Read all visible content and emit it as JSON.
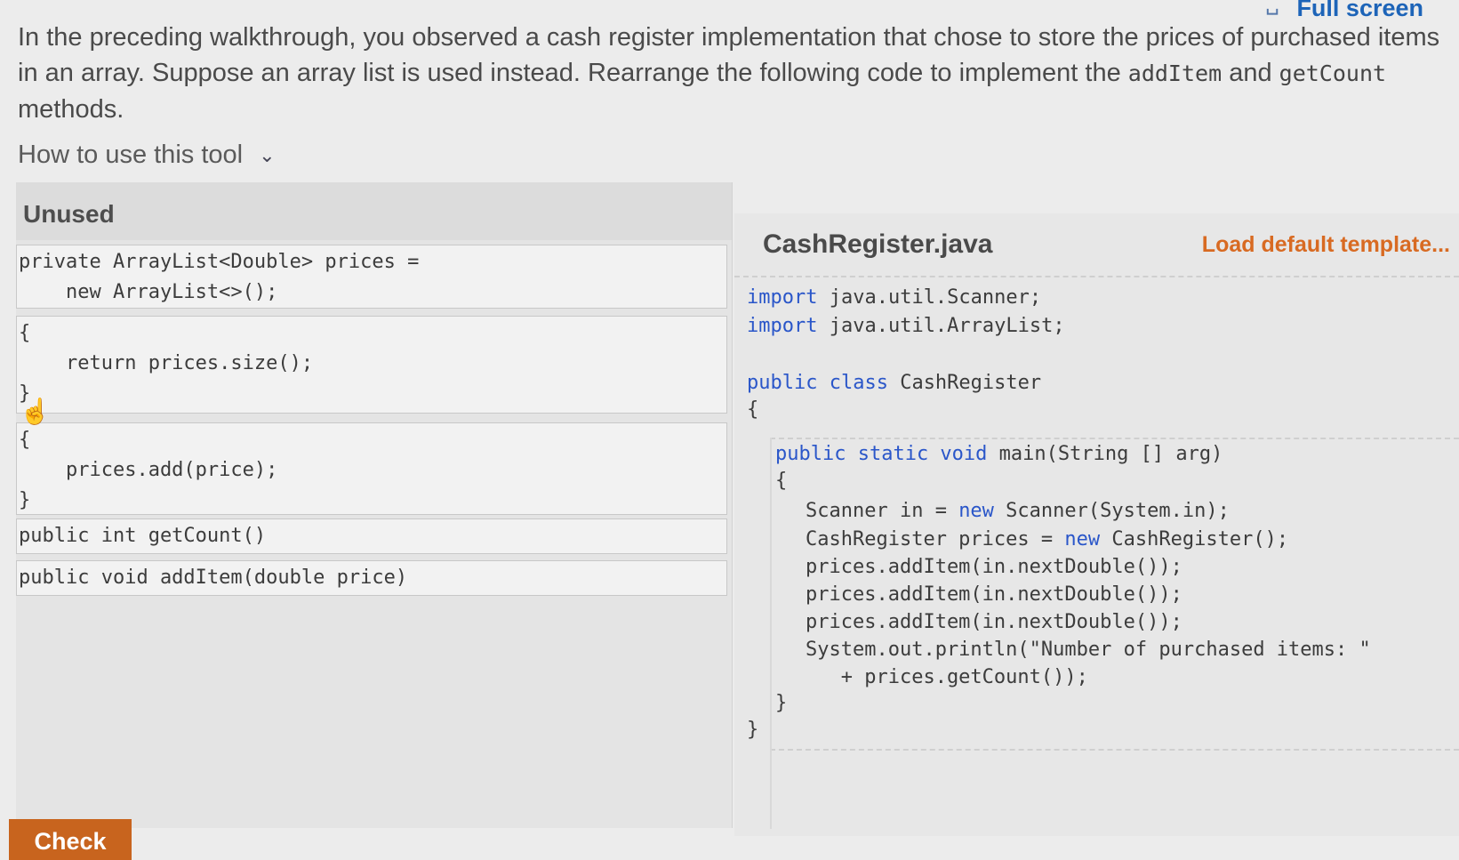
{
  "header": {
    "fullscreen_label": "Full screen",
    "fullscreen_icon": "expand-icon"
  },
  "instructions": {
    "part1": "In the preceding walkthrough, you observed a cash register implementation that chose to store the prices of purchased items in an array. Suppose an array list is used instead. Rearrange the following code to implement the ",
    "code1": "addItem",
    "part2": " and ",
    "code2": "getCount",
    "part3": " methods."
  },
  "howto": {
    "label": "How to use this tool",
    "icon": "chevron-down-icon"
  },
  "unused": {
    "title": "Unused",
    "tiles": [
      "private ArrayList<Double> prices =\n    new ArrayList<>();",
      "{\n    return prices.size();\n}",
      "{\n    prices.add(price);\n}",
      "public int getCount()",
      "public void addItem(double price)"
    ]
  },
  "editor": {
    "filename": "CashRegister.java",
    "load_template": "Load default template...",
    "lines": {
      "import1_kw": "import",
      "import1_rest": " java.util.Scanner;",
      "import2_kw": "import",
      "import2_rest": " java.util.ArrayList;",
      "class_kw": "public class",
      "class_rest": " CashRegister",
      "open_brace": "{",
      "main_kw": "public static void",
      "main_rest": " main(String [] arg)",
      "main_open": "{",
      "l1a": "Scanner in = ",
      "l1kw": "new",
      "l1b": " Scanner(System.in);",
      "l2a": "CashRegister prices = ",
      "l2kw": "new",
      "l2b": " CashRegister();",
      "l3": "prices.addItem(in.nextDouble());",
      "l4": "prices.addItem(in.nextDouble());",
      "l5": "prices.addItem(in.nextDouble());",
      "l6": "System.out.println(\"Number of purchased items: \"",
      "l7": "   + prices.getCount());",
      "main_close": "}",
      "class_close": "}"
    }
  },
  "check_label": "Check"
}
